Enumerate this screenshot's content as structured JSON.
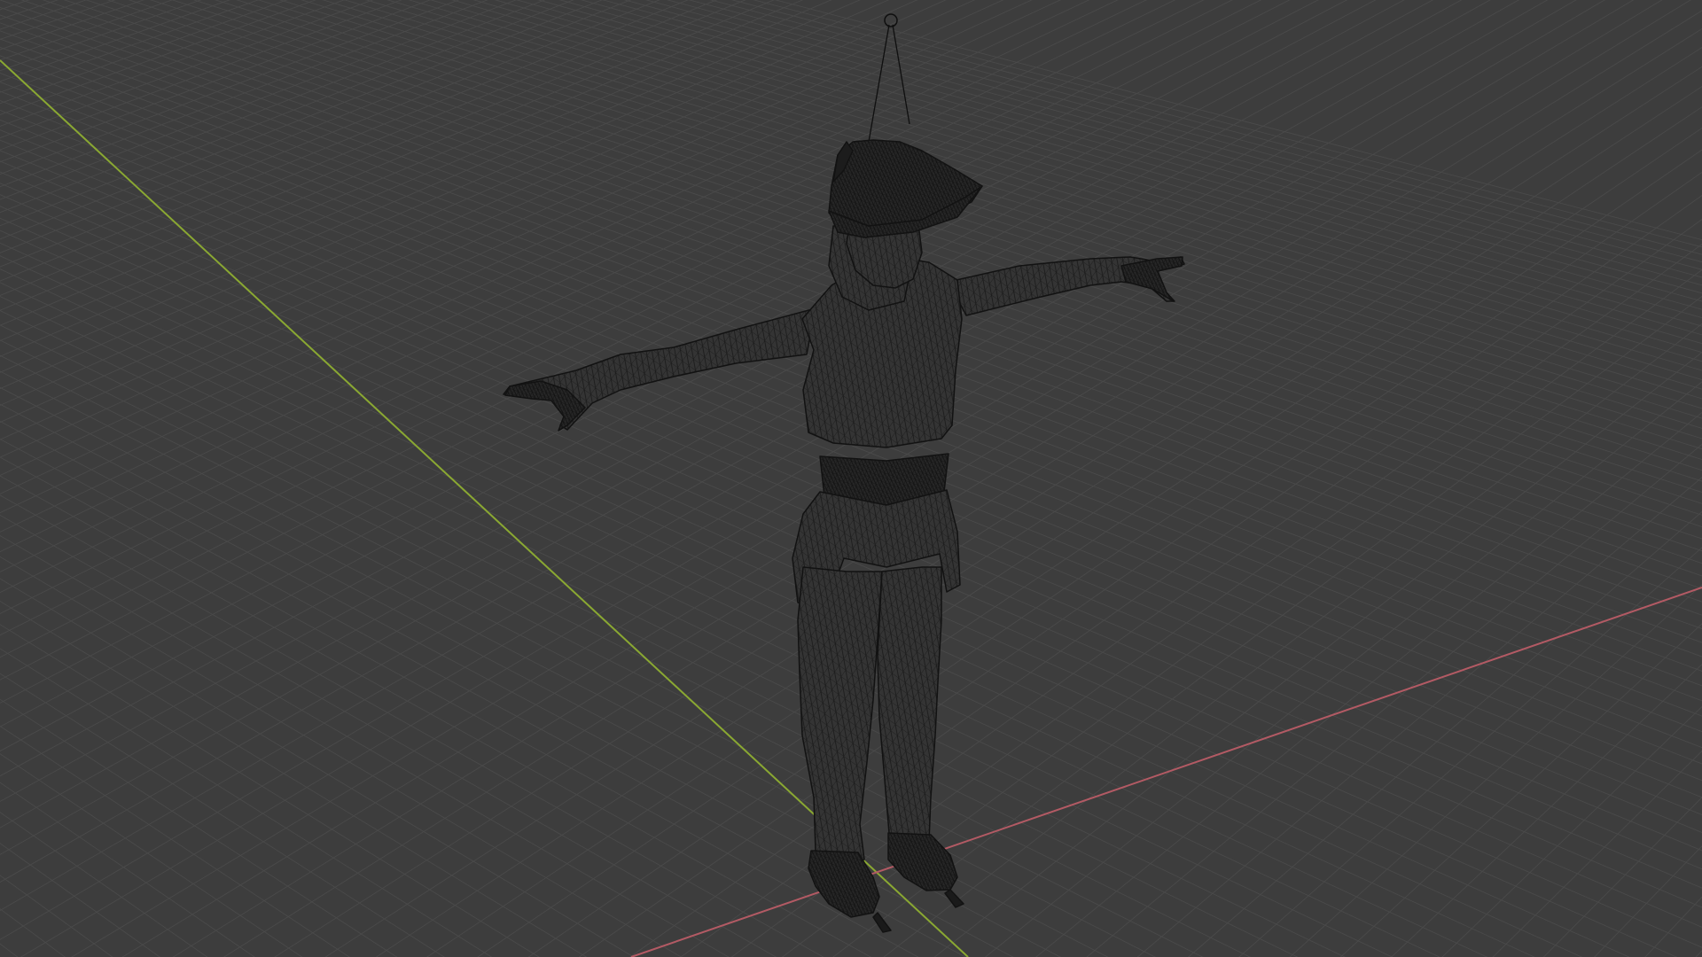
{
  "viewport": {
    "label": "",
    "shading": "wireframe",
    "background_color": "#3d3d3d",
    "grid": true,
    "grid_color": "#4a4a4a",
    "x_axis_color": "#b35a64",
    "y_axis_color": "#8aa832"
  },
  "scene": {
    "object": "character-mesh",
    "pose": "t-pose",
    "wire_color": "#161616",
    "has_armature_bone": true
  }
}
